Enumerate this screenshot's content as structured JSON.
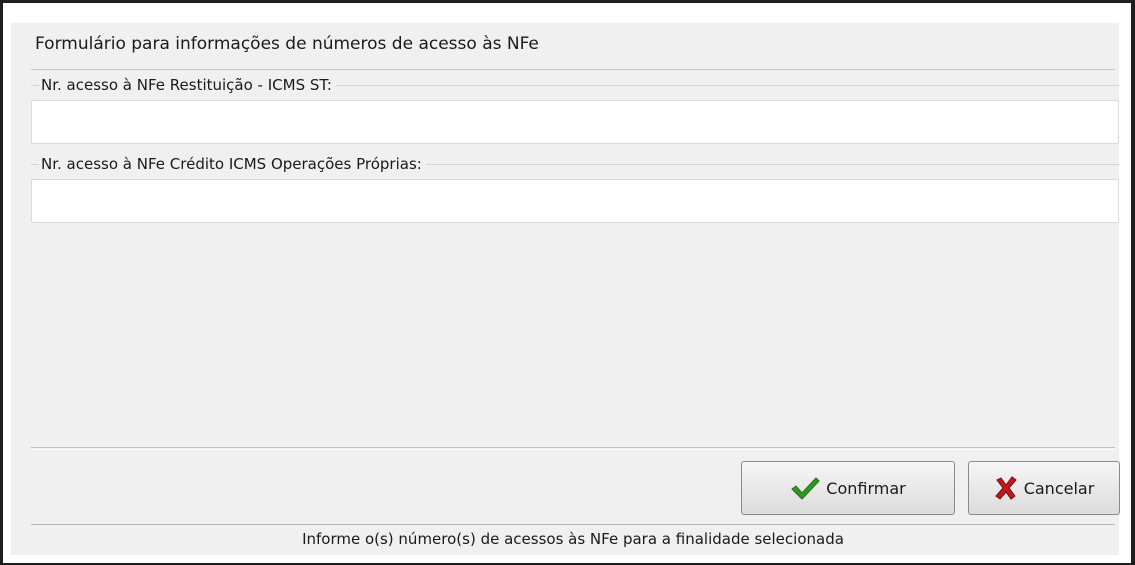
{
  "window": {
    "title": "Formulário para informações de números de acesso às NFe"
  },
  "form": {
    "restituicao": {
      "label": "Nr. acesso à NFe Restituição - ICMS ST:",
      "value": ""
    },
    "credito": {
      "label": "Nr. acesso à NFe Crédito ICMS Operações Próprias:",
      "value": ""
    }
  },
  "buttons": {
    "confirm_label": "Confirmar",
    "confirm_icon": "checkmark-icon",
    "cancel_label": "Cancelar",
    "cancel_icon": "x-cross-icon"
  },
  "status": {
    "text": "Informe o(s) número(s) de acessos às NFe para a finalidade selecionada"
  },
  "colors": {
    "confirm_icon": "#2e9b1e",
    "cancel_icon": "#c0171b",
    "dialog_bg": "#f0f0f0"
  }
}
